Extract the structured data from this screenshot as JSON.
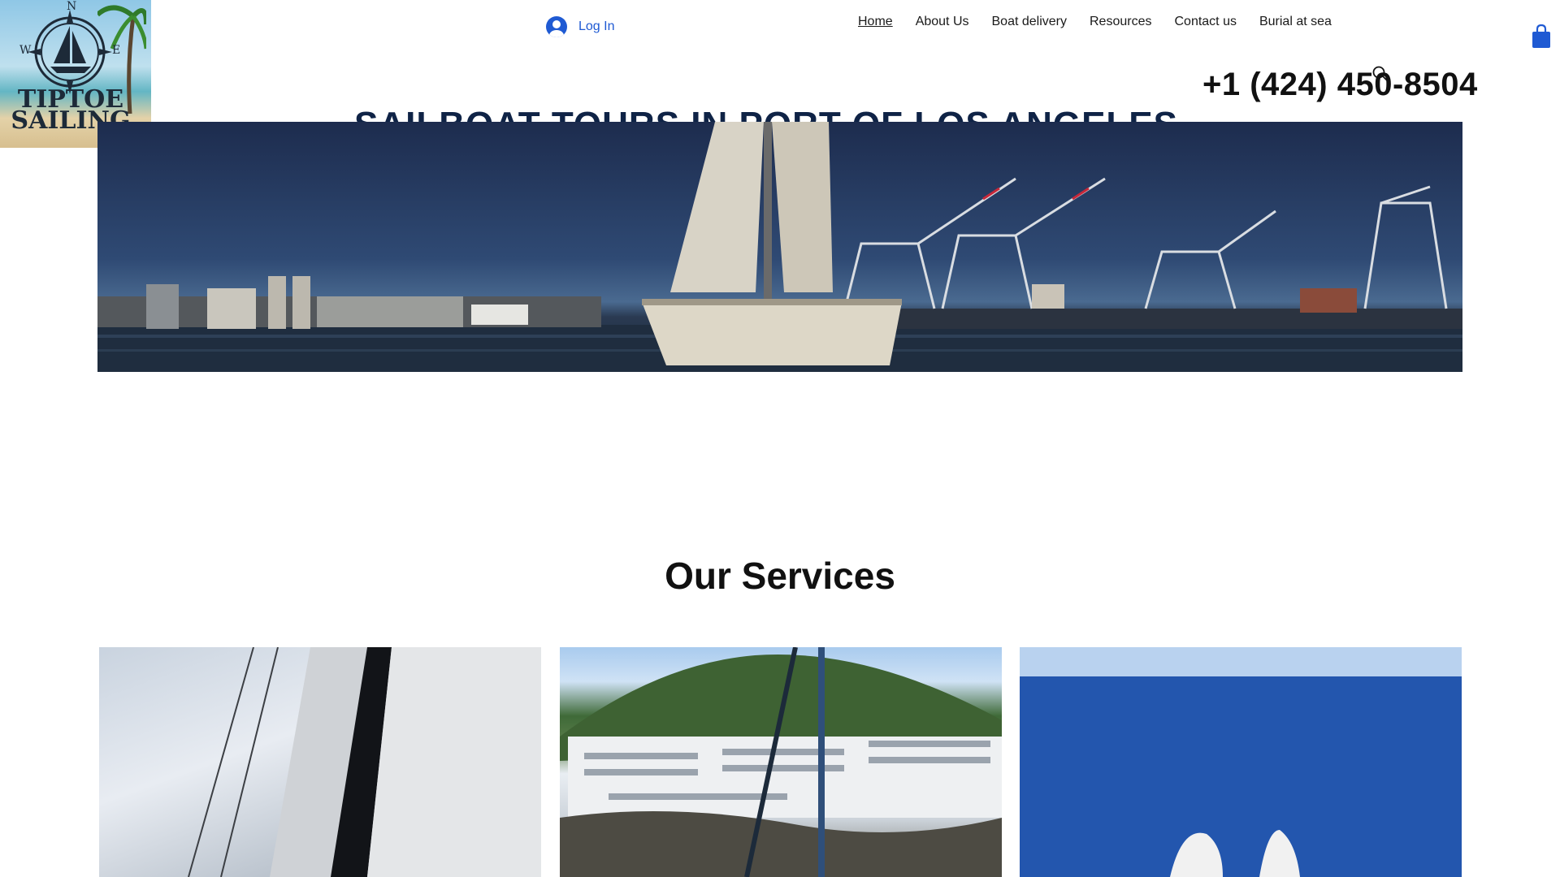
{
  "logo": {
    "line1": "TIPTOE",
    "line2": "SAILING",
    "compass_n": "N",
    "compass_w": "W",
    "compass_e": "E"
  },
  "header": {
    "login_label": "Log In",
    "nav": [
      "Home",
      "About Us",
      "Boat delivery",
      "Resources",
      "Contact us",
      "Burial at sea"
    ],
    "phone": "+1 (424) 450-8504"
  },
  "hero": {
    "title": "SAILBOAT TOURS IN PORT OF LOS ANGELES"
  },
  "services": {
    "title": "Our Services"
  },
  "colors": {
    "accent": "#1f5ad3",
    "hero_title": "#0f2346"
  }
}
